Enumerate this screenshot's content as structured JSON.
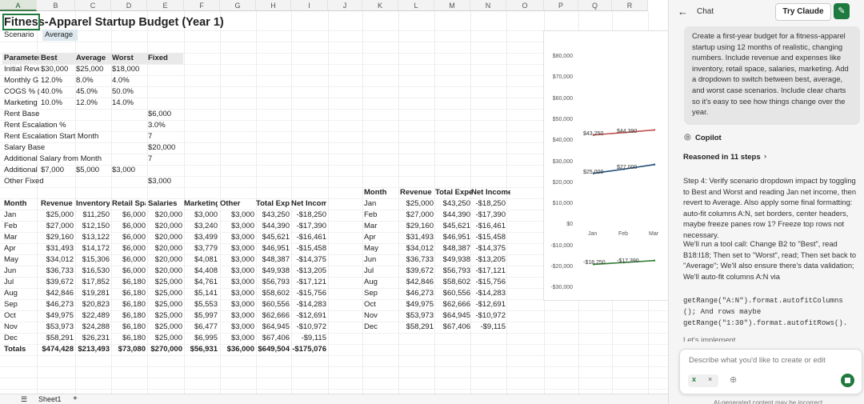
{
  "columns": [
    "A",
    "B",
    "C",
    "D",
    "E",
    "F",
    "G",
    "H",
    "I",
    "J",
    "K",
    "L",
    "M",
    "N",
    "O",
    "P",
    "Q",
    "R"
  ],
  "sheet": {
    "title": "Fitness-Apparel Startup Budget (Year 1)",
    "scenario_label": "Scenario",
    "scenario_value": "Average",
    "params_header": [
      "Parameter",
      "Best",
      "Average",
      "Worst",
      "Fixed"
    ],
    "params": [
      {
        "name": "Initial Reve",
        "best": "$30,000",
        "avg": "$25,000",
        "worst": "$18,000",
        "fixed": ""
      },
      {
        "name": "Monthly G",
        "best": "12.0%",
        "avg": "8.0%",
        "worst": "4.0%",
        "fixed": ""
      },
      {
        "name": "COGS % (I",
        "best": "40.0%",
        "avg": "45.0%",
        "worst": "50.0%",
        "fixed": ""
      },
      {
        "name": "Marketing",
        "best": "10.0%",
        "avg": "12.0%",
        "worst": "14.0%",
        "fixed": ""
      },
      {
        "name": "Rent Base",
        "best": "",
        "avg": "",
        "worst": "",
        "fixed": "$6,000"
      },
      {
        "name": "Rent Escalation %",
        "best": "",
        "avg": "",
        "worst": "",
        "fixed": "3.0%"
      },
      {
        "name": "Rent Escalation Start Month",
        "best": "",
        "avg": "",
        "worst": "",
        "fixed": "7"
      },
      {
        "name": "Salary Base",
        "best": "",
        "avg": "",
        "worst": "",
        "fixed": "$20,000"
      },
      {
        "name": "Additional Salary from Month",
        "best": "",
        "avg": "",
        "worst": "",
        "fixed": "7"
      },
      {
        "name": "Additional",
        "best": "$7,000",
        "avg": "$5,000",
        "worst": "$3,000",
        "fixed": ""
      },
      {
        "name": "Other Fixed",
        "best": "",
        "avg": "",
        "worst": "",
        "fixed": "$3,000"
      }
    ],
    "main_header": [
      "Month",
      "Revenue",
      "Inventory (",
      "Retail Spa",
      "Salaries",
      "Marketing",
      "Other",
      "Total Expe",
      "Net Income"
    ],
    "main_rows": [
      [
        "Jan",
        "$25,000",
        "$11,250",
        "$6,000",
        "$20,000",
        "$3,000",
        "$3,000",
        "$43,250",
        "-$18,250"
      ],
      [
        "Feb",
        "$27,000",
        "$12,150",
        "$6,000",
        "$20,000",
        "$3,240",
        "$3,000",
        "$44,390",
        "-$17,390"
      ],
      [
        "Mar",
        "$29,160",
        "$13,122",
        "$6,000",
        "$20,000",
        "$3,499",
        "$3,000",
        "$45,621",
        "-$16,461"
      ],
      [
        "Apr",
        "$31,493",
        "$14,172",
        "$6,000",
        "$20,000",
        "$3,779",
        "$3,000",
        "$46,951",
        "-$15,458"
      ],
      [
        "May",
        "$34,012",
        "$15,306",
        "$6,000",
        "$20,000",
        "$4,081",
        "$3,000",
        "$48,387",
        "-$14,375"
      ],
      [
        "Jun",
        "$36,733",
        "$16,530",
        "$6,000",
        "$20,000",
        "$4,408",
        "$3,000",
        "$49,938",
        "-$13,205"
      ],
      [
        "Jul",
        "$39,672",
        "$17,852",
        "$6,180",
        "$25,000",
        "$4,761",
        "$3,000",
        "$56,793",
        "-$17,121"
      ],
      [
        "Aug",
        "$42,846",
        "$19,281",
        "$6,180",
        "$25,000",
        "$5,141",
        "$3,000",
        "$58,602",
        "-$15,756"
      ],
      [
        "Sep",
        "$46,273",
        "$20,823",
        "$6,180",
        "$25,000",
        "$5,553",
        "$3,000",
        "$60,556",
        "-$14,283"
      ],
      [
        "Oct",
        "$49,975",
        "$22,489",
        "$6,180",
        "$25,000",
        "$5,997",
        "$3,000",
        "$62,666",
        "-$12,691"
      ],
      [
        "Nov",
        "$53,973",
        "$24,288",
        "$6,180",
        "$25,000",
        "$6,477",
        "$3,000",
        "$64,945",
        "-$10,972"
      ],
      [
        "Dec",
        "$58,291",
        "$26,231",
        "$6,180",
        "$25,000",
        "$6,995",
        "$3,000",
        "$67,406",
        "-$9,115"
      ]
    ],
    "totals": [
      "Totals",
      "$474,428",
      "$213,493",
      "$73,080",
      "$270,000",
      "$56,931",
      "$36,000",
      "$649,504",
      "-$175,076"
    ],
    "summary_header": [
      "Month",
      "Revenue",
      "Total Expe",
      "Net Income"
    ],
    "summary_rows": [
      [
        "Jan",
        "$25,000",
        "$43,250",
        "-$18,250"
      ],
      [
        "Feb",
        "$27,000",
        "$44,390",
        "-$17,390"
      ],
      [
        "Mar",
        "$29,160",
        "$45,621",
        "-$16,461"
      ],
      [
        "Apr",
        "$31,493",
        "$46,951",
        "-$15,458"
      ],
      [
        "May",
        "$34,012",
        "$48,387",
        "-$14,375"
      ],
      [
        "Jun",
        "$36,733",
        "$49,938",
        "-$13,205"
      ],
      [
        "Jul",
        "$39,672",
        "$56,793",
        "-$17,121"
      ],
      [
        "Aug",
        "$42,846",
        "$58,602",
        "-$15,756"
      ],
      [
        "Sep",
        "$46,273",
        "$60,556",
        "-$14,283"
      ],
      [
        "Oct",
        "$49,975",
        "$62,666",
        "-$12,691"
      ],
      [
        "Nov",
        "$53,973",
        "$64,945",
        "-$10,972"
      ],
      [
        "Dec",
        "$58,291",
        "$67,406",
        "-$9,115"
      ]
    ],
    "sheet_tab": "Sheet1",
    "add_sheet": "+"
  },
  "chart_data": {
    "type": "line",
    "categories": [
      "Jan",
      "Feb",
      "Mar"
    ],
    "series": [
      {
        "values": [
          43250,
          44390,
          45621
        ],
        "color": "#c0504d"
      },
      {
        "values": [
          25000,
          27000,
          29160
        ],
        "color": "#1f4e79"
      },
      {
        "values": [
          -18250,
          -17390,
          -16461
        ],
        "color": "#2e7d32"
      }
    ],
    "data_labels": {
      "expenses": [
        "$43,250",
        "$44,390"
      ],
      "revenue": [
        "$25,000",
        "$27,000"
      ],
      "net": [
        "-$18,250",
        "-$17,390"
      ]
    },
    "yticks": [
      "$80,000",
      "$70,000",
      "$60,000",
      "$50,000",
      "$40,000",
      "$30,000",
      "$20,000",
      "$10,000",
      "$0",
      "-$10,000",
      "-$20,000",
      "-$30,000"
    ],
    "ylim": [
      -30000,
      80000
    ]
  },
  "chat": {
    "title": "Chat",
    "back_icon": "arrow-left-icon",
    "try_claude": "Try Claude",
    "new_chat_icon": "compose-icon",
    "user_message": "Create a first-year budget for a fitness-apparel startup using 12 months of realistic, changing numbers. Include revenue and expenses like inventory, retail space, salaries, marketing. Add a dropdown to switch between best, average, and worst case scenarios. Include clear charts so it's easy to see how things change over the year.",
    "assistant_name": "Copilot",
    "reasoned": "Reasoned in 11 steps",
    "step4": "Step 4: Verify scenario dropdown impact by toggling to Best and Worst and reading Jan net income, then revert to Average. Also apply some final formatting: auto-fit columns A:N, set borders, center headers, maybe freeze panes row 1? Freeze top rows not necessary.",
    "plan_intro": "We'll run a tool call: Change B2 to \"Best\", read B18:I18; Then set to \"Worst\", read; Then set back to \"Average\"; We'll also ensure there's data validation; We'll auto-fit columns A:N via",
    "code1": "getRange(\"A:N\").format.autofitColumns",
    "code1b": "(); And rows maybe",
    "code2": "getRange(\"1:30\").format.autofitRows().",
    "lets": "Let's implement",
    "input_placeholder": "Describe what you'd like to create or edit",
    "footer": "AI-generated content may be incorrect"
  }
}
